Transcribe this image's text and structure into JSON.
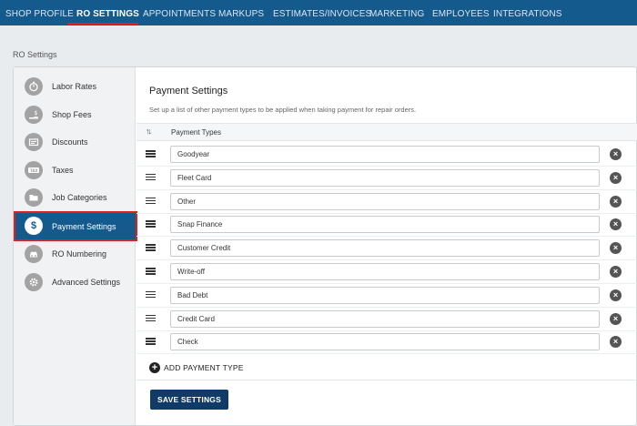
{
  "nav": {
    "items": [
      {
        "label": "SHOP PROFILE"
      },
      {
        "label": "RO SETTINGS",
        "active": true
      },
      {
        "label": "APPOINTMENTS"
      },
      {
        "label": "MARKUPS"
      },
      {
        "label": "ESTIMATES/INVOICES"
      },
      {
        "label": "MARKETING"
      },
      {
        "label": "EMPLOYEES"
      },
      {
        "label": "INTEGRATIONS"
      }
    ]
  },
  "breadcrumb": "RO Settings",
  "sidebar": {
    "items": [
      {
        "label": "Labor Rates",
        "icon": "stopwatch-icon"
      },
      {
        "label": "Shop Fees",
        "icon": "money-hand-icon"
      },
      {
        "label": "Discounts",
        "icon": "coupon-icon"
      },
      {
        "label": "Taxes",
        "icon": "tax-icon"
      },
      {
        "label": "Job Categories",
        "icon": "folder-icon"
      },
      {
        "label": "Payment Settings",
        "icon": "dollar-icon",
        "active": true
      },
      {
        "label": "RO Numbering",
        "icon": "car-icon"
      },
      {
        "label": "Advanced Settings",
        "icon": "gear-icon"
      }
    ]
  },
  "main": {
    "title": "Payment Settings",
    "subtitle": "Set up a list of other payment types to be applied when taking payment for repair orders.",
    "column_header": "Payment Types",
    "payment_types": [
      "Goodyear",
      "Fleet Card",
      "Other",
      "Snap Finance",
      "Customer Credit",
      "Write-off",
      "Bad Debt",
      "Credit Card",
      "Check"
    ],
    "add_label": "ADD PAYMENT TYPE",
    "save_label": "SAVE SETTINGS"
  },
  "colors": {
    "nav_bg": "#145a8c",
    "active_highlight": "#e02020",
    "save_button": "#0f3b66"
  }
}
